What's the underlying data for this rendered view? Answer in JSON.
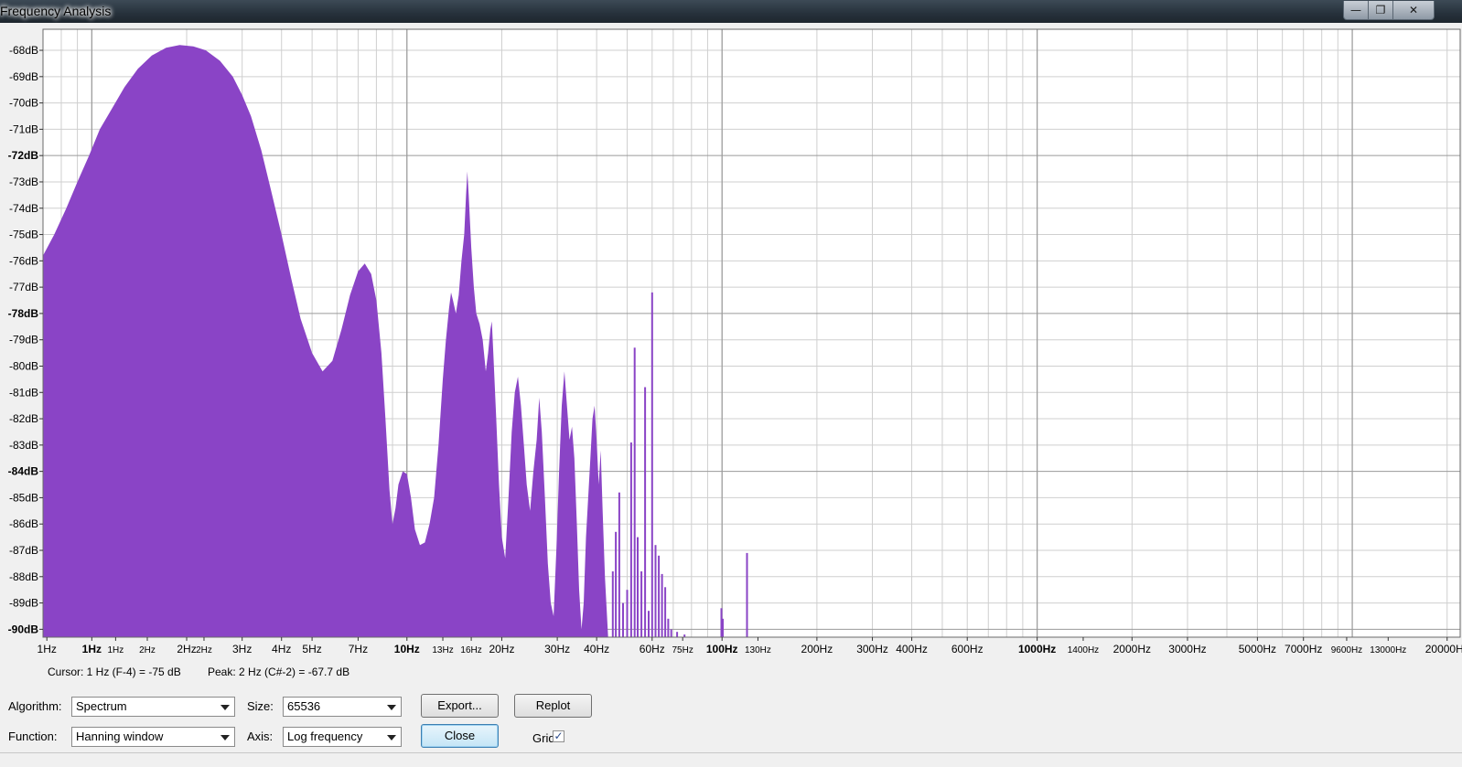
{
  "window": {
    "title": "Frequency Analysis",
    "minimize_glyph": "—",
    "maximize_glyph": "❐",
    "close_glyph": "✕"
  },
  "colors": {
    "spectrum_fill": "#8a44c6",
    "plot_background": "#ffffff",
    "grid_major": "#9a9a9a",
    "grid_minor": "#cfcfcf"
  },
  "chart_data": {
    "type": "area",
    "xscale": "log",
    "xlim_hz": [
      0.7,
      22000
    ],
    "ylim_db": [
      -90.3,
      -67.2
    ],
    "grid": true,
    "y_ticks": [
      {
        "label": "-68dB",
        "value": -68,
        "major": false
      },
      {
        "label": "-69dB",
        "value": -69,
        "major": false
      },
      {
        "label": "-70dB",
        "value": -70,
        "major": false
      },
      {
        "label": "-71dB",
        "value": -71,
        "major": false
      },
      {
        "label": "-72dB",
        "value": -72,
        "major": true
      },
      {
        "label": "-73dB",
        "value": -73,
        "major": false
      },
      {
        "label": "-74dB",
        "value": -74,
        "major": false
      },
      {
        "label": "-75dB",
        "value": -75,
        "major": false
      },
      {
        "label": "-76dB",
        "value": -76,
        "major": false
      },
      {
        "label": "-77dB",
        "value": -77,
        "major": false
      },
      {
        "label": "-78dB",
        "value": -78,
        "major": true
      },
      {
        "label": "-79dB",
        "value": -79,
        "major": false
      },
      {
        "label": "-80dB",
        "value": -80,
        "major": false
      },
      {
        "label": "-81dB",
        "value": -81,
        "major": false
      },
      {
        "label": "-82dB",
        "value": -82,
        "major": false
      },
      {
        "label": "-83dB",
        "value": -83,
        "major": false
      },
      {
        "label": "-84dB",
        "value": -84,
        "major": true
      },
      {
        "label": "-85dB",
        "value": -85,
        "major": false
      },
      {
        "label": "-86dB",
        "value": -86,
        "major": false
      },
      {
        "label": "-87dB",
        "value": -87,
        "major": false
      },
      {
        "label": "-88dB",
        "value": -88,
        "major": false
      },
      {
        "label": "-89dB",
        "value": -89,
        "major": false
      },
      {
        "label": "-90dB",
        "value": -90,
        "major": true
      }
    ],
    "x_ticks": [
      {
        "label": "1Hz",
        "value": 0.72,
        "size": "med"
      },
      {
        "label": "1Hz",
        "value": 1,
        "size": "big"
      },
      {
        "label": "1Hz",
        "value": 1.19,
        "size": "small"
      },
      {
        "label": "2Hz",
        "value": 1.5,
        "size": "small"
      },
      {
        "label": "2Hz",
        "value": 2,
        "size": "med"
      },
      {
        "label": "2Hz",
        "value": 2.27,
        "size": "small"
      },
      {
        "label": "3Hz",
        "value": 3,
        "size": "med"
      },
      {
        "label": "4Hz",
        "value": 4,
        "size": "med"
      },
      {
        "label": "5Hz",
        "value": 5,
        "size": "med"
      },
      {
        "label": "7Hz",
        "value": 7,
        "size": "med"
      },
      {
        "label": "10Hz",
        "value": 10,
        "size": "big"
      },
      {
        "label": "13Hz",
        "value": 13,
        "size": "small"
      },
      {
        "label": "16Hz",
        "value": 16,
        "size": "small"
      },
      {
        "label": "20Hz",
        "value": 20,
        "size": "med"
      },
      {
        "label": "30Hz",
        "value": 30,
        "size": "med"
      },
      {
        "label": "40Hz",
        "value": 40,
        "size": "med"
      },
      {
        "label": "60Hz",
        "value": 60,
        "size": "med"
      },
      {
        "label": "75Hz",
        "value": 75,
        "size": "small"
      },
      {
        "label": "100Hz",
        "value": 100,
        "size": "big"
      },
      {
        "label": "130Hz",
        "value": 130,
        "size": "small"
      },
      {
        "label": "200Hz",
        "value": 200,
        "size": "med"
      },
      {
        "label": "300Hz",
        "value": 300,
        "size": "med"
      },
      {
        "label": "400Hz",
        "value": 400,
        "size": "med"
      },
      {
        "label": "600Hz",
        "value": 600,
        "size": "med"
      },
      {
        "label": "1000Hz",
        "value": 1000,
        "size": "big"
      },
      {
        "label": "1400Hz",
        "value": 1400,
        "size": "small"
      },
      {
        "label": "2000Hz",
        "value": 2000,
        "size": "med"
      },
      {
        "label": "3000Hz",
        "value": 3000,
        "size": "med"
      },
      {
        "label": "5000Hz",
        "value": 5000,
        "size": "med"
      },
      {
        "label": "7000Hz",
        "value": 7000,
        "size": "med"
      },
      {
        "label": "9600Hz",
        "value": 9600,
        "size": "small"
      },
      {
        "label": "13000Hz",
        "value": 13000,
        "size": "small"
      },
      {
        "label": "20000Hz",
        "value": 20000,
        "size": "med"
      }
    ],
    "spectrum_points": [
      [
        0.7,
        -75.8
      ],
      [
        0.76,
        -75
      ],
      [
        0.83,
        -74
      ],
      [
        0.9,
        -73
      ],
      [
        0.98,
        -72
      ],
      [
        1.06,
        -71
      ],
      [
        1.16,
        -70.2
      ],
      [
        1.27,
        -69.4
      ],
      [
        1.4,
        -68.7
      ],
      [
        1.55,
        -68.2
      ],
      [
        1.72,
        -67.9
      ],
      [
        1.9,
        -67.8
      ],
      [
        2.1,
        -67.85
      ],
      [
        2.3,
        -68
      ],
      [
        2.55,
        -68.4
      ],
      [
        2.8,
        -69
      ],
      [
        3.0,
        -69.7
      ],
      [
        3.2,
        -70.5
      ],
      [
        3.45,
        -71.8
      ],
      [
        3.7,
        -73.3
      ],
      [
        4.0,
        -75
      ],
      [
        4.3,
        -76.7
      ],
      [
        4.6,
        -78.2
      ],
      [
        5.0,
        -79.5
      ],
      [
        5.4,
        -80.2
      ],
      [
        5.8,
        -79.8
      ],
      [
        6.2,
        -78.6
      ],
      [
        6.6,
        -77.3
      ],
      [
        7.0,
        -76.4
      ],
      [
        7.35,
        -76.1
      ],
      [
        7.7,
        -76.5
      ],
      [
        8.0,
        -77.5
      ],
      [
        8.3,
        -79.5
      ],
      [
        8.55,
        -82
      ],
      [
        8.8,
        -84.7
      ],
      [
        9.0,
        -86
      ],
      [
        9.2,
        -85.4
      ],
      [
        9.4,
        -84.5
      ],
      [
        9.7,
        -84
      ],
      [
        10.0,
        -84.1
      ],
      [
        10.3,
        -85
      ],
      [
        10.6,
        -86.2
      ],
      [
        11.0,
        -86.8
      ],
      [
        11.4,
        -86.7
      ],
      [
        11.8,
        -86
      ],
      [
        12.2,
        -85
      ],
      [
        12.6,
        -83
      ],
      [
        13.0,
        -80.5
      ],
      [
        13.3,
        -79
      ],
      [
        13.6,
        -77.8
      ],
      [
        13.8,
        -77.2
      ],
      [
        14.0,
        -77.5
      ],
      [
        14.3,
        -78
      ],
      [
        14.6,
        -77.3
      ],
      [
        14.9,
        -76
      ],
      [
        15.2,
        -75
      ],
      [
        15.4,
        -73.5
      ],
      [
        15.55,
        -72.6
      ],
      [
        15.7,
        -73.5
      ],
      [
        16.0,
        -75.5
      ],
      [
        16.3,
        -77
      ],
      [
        16.6,
        -78
      ],
      [
        17.0,
        -78.4
      ],
      [
        17.4,
        -79
      ],
      [
        17.8,
        -80.2
      ],
      [
        18.1,
        -79.5
      ],
      [
        18.4,
        -78.6
      ],
      [
        18.6,
        -78.3
      ],
      [
        18.8,
        -79.5
      ],
      [
        19.2,
        -82
      ],
      [
        19.6,
        -84.5
      ],
      [
        20.0,
        -86.5
      ],
      [
        20.5,
        -87.3
      ],
      [
        21.0,
        -85
      ],
      [
        21.5,
        -82.5
      ],
      [
        22.0,
        -81
      ],
      [
        22.5,
        -80.4
      ],
      [
        23.0,
        -81.5
      ],
      [
        23.5,
        -83
      ],
      [
        24.0,
        -84.5
      ],
      [
        24.6,
        -85.5
      ],
      [
        25.2,
        -84
      ],
      [
        25.8,
        -82.8
      ],
      [
        26.3,
        -81.2
      ],
      [
        26.8,
        -82.5
      ],
      [
        27.4,
        -85
      ],
      [
        28.0,
        -87.5
      ],
      [
        28.6,
        -89
      ],
      [
        29.2,
        -89.5
      ],
      [
        29.8,
        -87
      ],
      [
        30.4,
        -84
      ],
      [
        31.0,
        -81.5
      ],
      [
        31.6,
        -80.2
      ],
      [
        32.2,
        -81.5
      ],
      [
        32.8,
        -82.8
      ],
      [
        33.4,
        -82.3
      ],
      [
        34.0,
        -83.5
      ],
      [
        34.6,
        -86
      ],
      [
        35.2,
        -88.5
      ],
      [
        35.8,
        -90
      ],
      [
        36.4,
        -89
      ],
      [
        37.0,
        -86.5
      ],
      [
        37.6,
        -85
      ],
      [
        38.2,
        -83.5
      ],
      [
        38.8,
        -82
      ],
      [
        39.4,
        -81.5
      ],
      [
        40.0,
        -82.8
      ],
      [
        40.6,
        -84.5
      ],
      [
        41.2,
        -83.2
      ],
      [
        41.8,
        -85.5
      ],
      [
        42.5,
        -88
      ],
      [
        43.5,
        -90.3
      ]
    ],
    "spikes": [
      [
        45.0,
        -87.8
      ],
      [
        46.0,
        -86.3
      ],
      [
        47.2,
        -84.8
      ],
      [
        48.5,
        -89
      ],
      [
        50.0,
        -88.5
      ],
      [
        51.5,
        -82.9
      ],
      [
        52.8,
        -79.3
      ],
      [
        54.0,
        -86.5
      ],
      [
        55.5,
        -87.8
      ],
      [
        57.0,
        -80.8
      ],
      [
        58.5,
        -89.3
      ],
      [
        60.0,
        -77.2
      ],
      [
        61.5,
        -86.8
      ],
      [
        63.0,
        -87.2
      ],
      [
        64.5,
        -87.9
      ],
      [
        66.0,
        -88.4
      ],
      [
        67.5,
        -89.6
      ],
      [
        69.0,
        -90.0
      ],
      [
        72.0,
        -90.1
      ],
      [
        76.0,
        -90.2
      ],
      [
        99.5,
        -89.2
      ],
      [
        100.5,
        -89.6
      ],
      [
        120.0,
        -87.1
      ]
    ]
  },
  "status": {
    "cursor_text": "Cursor: 1 Hz (F-4) = -75 dB",
    "peak_text": "Peak: 2 Hz (C#-2) = -67.7 dB"
  },
  "controls": {
    "algorithm_label": "Algorithm:",
    "algorithm_value": "Spectrum",
    "function_label": "Function:",
    "function_value": "Hanning window",
    "size_label": "Size:",
    "size_value": "65536",
    "axis_label": "Axis:",
    "axis_value": "Log frequency",
    "export_label": "Export...",
    "close_label": "Close",
    "replot_label": "Replot",
    "grids_label": "Grids",
    "grids_checked": true,
    "check_glyph": "✓"
  }
}
